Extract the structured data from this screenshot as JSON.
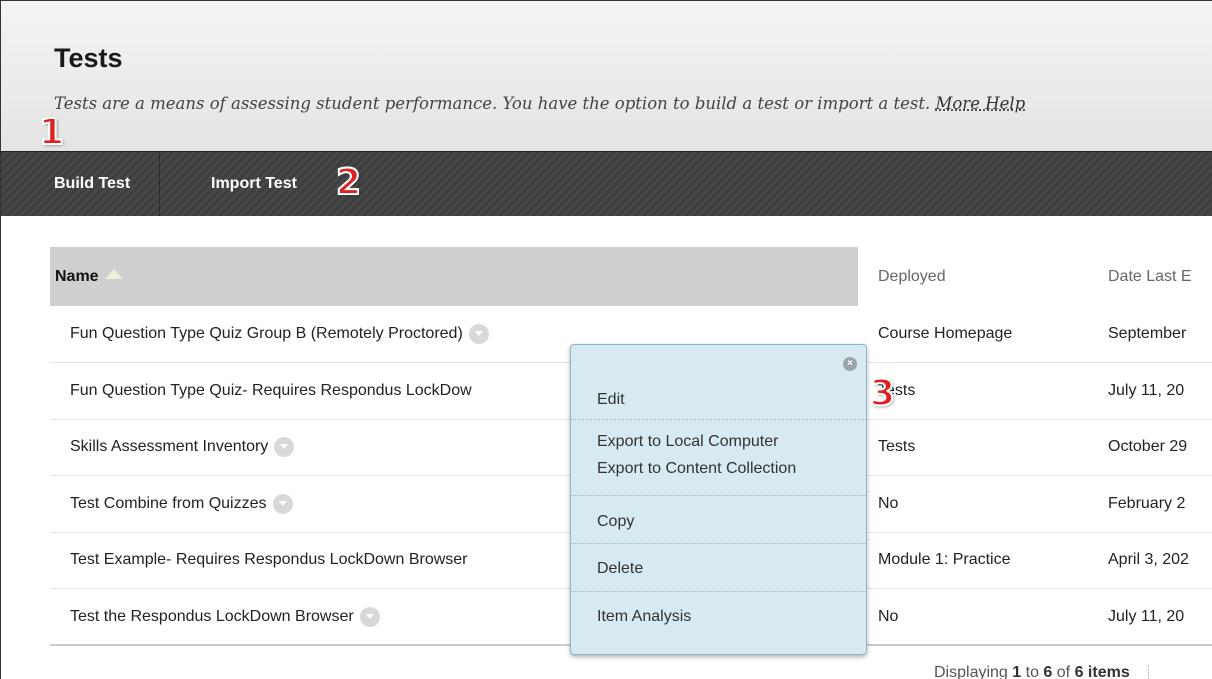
{
  "header": {
    "title": "Tests",
    "description": "Tests are a means of assessing student performance. You have the option to build a test or import a test.",
    "more_help": "More Help"
  },
  "toolbar": {
    "build_test": "Build Test",
    "import_test": "Import Test"
  },
  "callouts": [
    "1",
    "2",
    "3"
  ],
  "table": {
    "columns": [
      "Name",
      "Deployed",
      "Date Last E"
    ],
    "rows": [
      {
        "name": "Fun Question Type Quiz Group B (Remotely Proctored)",
        "deployed": "Course Homepage",
        "date": "September"
      },
      {
        "name": "Fun Question Type Quiz- Requires Respondus LockDow",
        "deployed": "Tests",
        "date": "July 11, 20"
      },
      {
        "name": "Skills Assessment Inventory",
        "deployed": "Tests",
        "date": "October 29"
      },
      {
        "name": "Test Combine from Quizzes",
        "deployed": "No",
        "date": "February 2"
      },
      {
        "name": "Test Example- Requires Respondus LockDown Browser",
        "deployed": "Module 1: Practice",
        "date": "April 3, 202"
      },
      {
        "name": "Test the Respondus LockDown Browser",
        "deployed": "No",
        "date": "July 11, 20"
      }
    ]
  },
  "context_menu": {
    "items": [
      "Edit",
      "Export to Local Computer",
      "Export to Content Collection",
      "Copy",
      "Delete",
      "Item Analysis"
    ]
  },
  "footer": {
    "displaying": "Displaying",
    "from": "1",
    "to_word": "to",
    "to": "6",
    "of_word": "of",
    "total": "6 items"
  }
}
